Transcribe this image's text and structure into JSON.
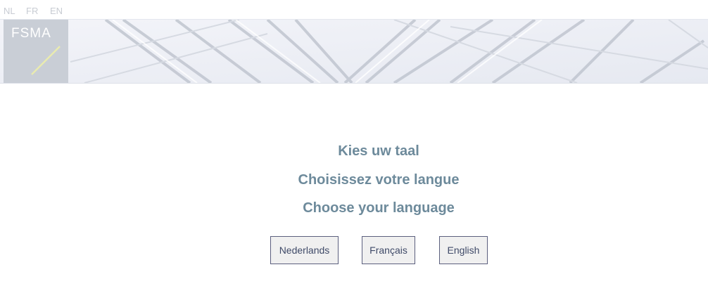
{
  "topbar": {
    "languages": [
      {
        "code": "NL"
      },
      {
        "code": "FR"
      },
      {
        "code": "EN"
      }
    ]
  },
  "logo": {
    "text": "FSMA"
  },
  "main": {
    "headings": [
      "Kies uw taal",
      "Choisissez votre langue",
      "Choose your language"
    ],
    "buttons": [
      {
        "label": "Nederlands"
      },
      {
        "label": "Français"
      },
      {
        "label": "English"
      }
    ]
  },
  "colors": {
    "heading": "#6d8a9b",
    "logo_background": "#c9ced6",
    "logo_slash": "#e9ebb0",
    "button_border": "#5b5f7e"
  }
}
